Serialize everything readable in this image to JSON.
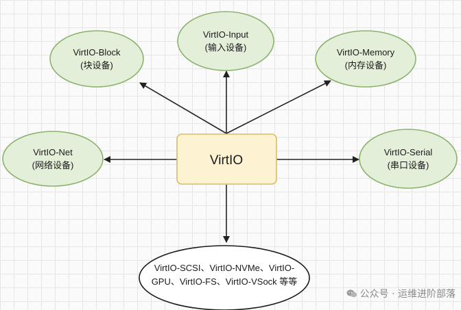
{
  "diagram": {
    "center": {
      "label": "VirtIO"
    },
    "nodes": {
      "block": {
        "line1": "VirtIO-Block",
        "line2": "(块设备)"
      },
      "input": {
        "line1": "VirtIO-Input",
        "line2": "(输入设备)"
      },
      "memory": {
        "line1": "VirtIO-Memory",
        "line2": "(内存设备)"
      },
      "net": {
        "line1": "VirtIO-Net",
        "line2": "(网络设备)"
      },
      "serial": {
        "line1": "VirtIO-Serial",
        "line2": "(串口设备)"
      },
      "others": {
        "line1": "VirtIO-SCSI、VirtIO-NVMe、VirtIO-",
        "line2": "GPU、VirtIO-FS、VirtIO-VSock 等等"
      }
    },
    "edges": [
      {
        "from": "center",
        "to": "block"
      },
      {
        "from": "center",
        "to": "input"
      },
      {
        "from": "center",
        "to": "memory"
      },
      {
        "from": "center",
        "to": "net"
      },
      {
        "from": "center",
        "to": "serial"
      },
      {
        "from": "center",
        "to": "others"
      }
    ]
  },
  "watermark": {
    "text": "公众号 · 运维进阶部落",
    "icon": "wechat-icon"
  },
  "colors": {
    "green_fill": "#e3efd9",
    "green_stroke": "#8bb26c",
    "center_fill": "#fdf3d3",
    "center_stroke": "#d8bb62",
    "edge": "#222222"
  }
}
